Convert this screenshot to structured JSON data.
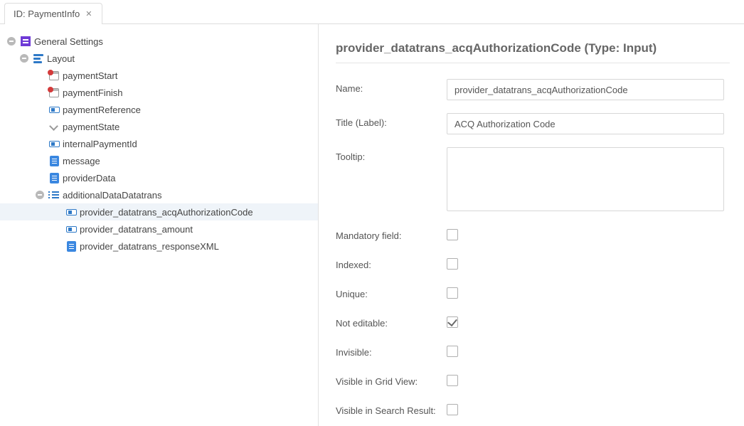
{
  "tab": {
    "label": "ID: PaymentInfo"
  },
  "tree": {
    "general_settings": "General Settings",
    "layout": "Layout",
    "items": [
      {
        "label": "paymentStart",
        "icon": "calendar"
      },
      {
        "label": "paymentFinish",
        "icon": "calendar"
      },
      {
        "label": "paymentReference",
        "icon": "input"
      },
      {
        "label": "paymentState",
        "icon": "chevron"
      },
      {
        "label": "internalPaymentId",
        "icon": "input"
      },
      {
        "label": "message",
        "icon": "text"
      },
      {
        "label": "providerData",
        "icon": "text"
      }
    ],
    "additional": {
      "label": "additionalDataDatatrans",
      "children": [
        {
          "label": "provider_datatrans_acqAuthorizationCode",
          "icon": "input",
          "selected": true
        },
        {
          "label": "provider_datatrans_amount",
          "icon": "input"
        },
        {
          "label": "provider_datatrans_responseXML",
          "icon": "text"
        }
      ]
    }
  },
  "detail": {
    "title": "provider_datatrans_acqAuthorizationCode (Type: Input)",
    "labels": {
      "name": "Name:",
      "title": "Title (Label):",
      "tooltip": "Tooltip:",
      "mandatory": "Mandatory field:",
      "indexed": "Indexed:",
      "unique": "Unique:",
      "not_editable": "Not editable:",
      "invisible": "Invisible:",
      "visible_grid": "Visible in Grid View:",
      "visible_search": "Visible in Search Result:"
    },
    "values": {
      "name": "provider_datatrans_acqAuthorizationCode",
      "title": "ACQ Authorization Code",
      "tooltip": "",
      "mandatory": false,
      "indexed": false,
      "unique": false,
      "not_editable": true,
      "invisible": false,
      "visible_grid": false,
      "visible_search": false
    }
  }
}
